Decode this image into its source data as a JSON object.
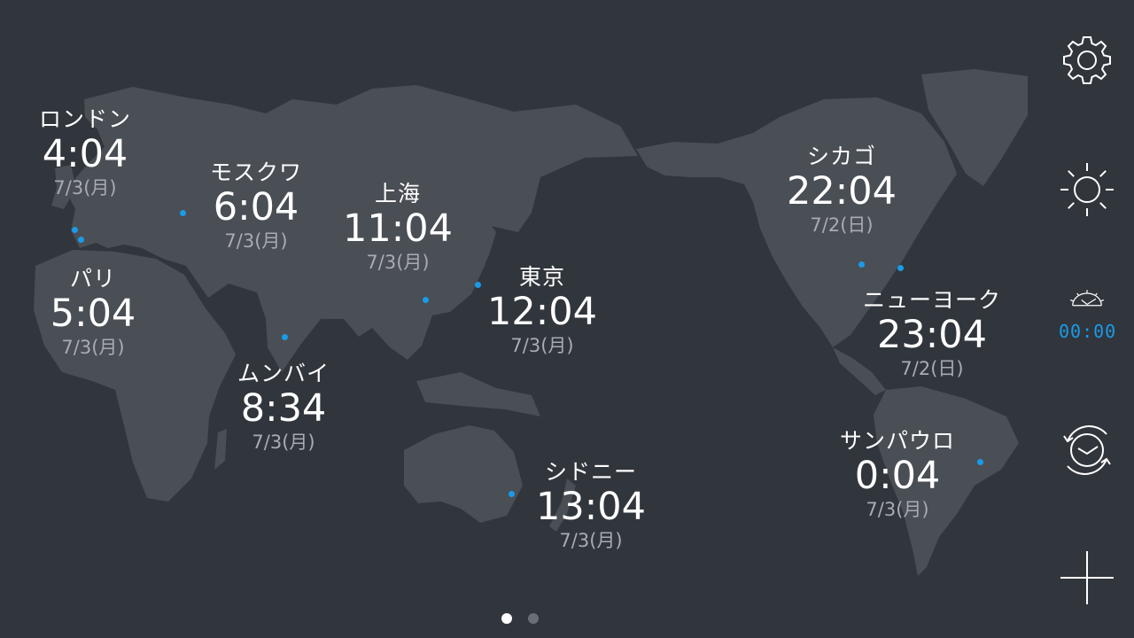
{
  "colors": {
    "background": "#31353c",
    "land": "#4a4e55",
    "accent": "#1a9be8",
    "date_text": "#a8acb2",
    "page_indicator_active": "#ffffff",
    "page_indicator_inactive": "#6a6e75"
  },
  "cities": [
    {
      "name": "ロンドン",
      "time": "4:04",
      "date": "7/3(月)"
    },
    {
      "name": "モスクワ",
      "time": "6:04",
      "date": "7/3(月)"
    },
    {
      "name": "上海",
      "time": "11:04",
      "date": "7/3(月)"
    },
    {
      "name": "パリ",
      "time": "5:04",
      "date": "7/3(月)"
    },
    {
      "name": "東京",
      "time": "12:04",
      "date": "7/3(月)"
    },
    {
      "name": "ムンバイ",
      "time": "8:34",
      "date": "7/3(月)"
    },
    {
      "name": "シドニー",
      "time": "13:04",
      "date": "7/3(月)"
    },
    {
      "name": "シカゴ",
      "time": "22:04",
      "date": "7/2(日)"
    },
    {
      "name": "ニューヨーク",
      "time": "23:04",
      "date": "7/2(日)"
    },
    {
      "name": "サンパウロ",
      "time": "0:04",
      "date": "7/3(月)"
    }
  ],
  "sidebar": {
    "items": [
      {
        "icon": "gear-icon"
      },
      {
        "icon": "brightness-icon"
      },
      {
        "icon": "alarm-clock-icon",
        "label": "00:00"
      },
      {
        "icon": "rotate-clock-icon"
      },
      {
        "icon": "plus-icon"
      }
    ]
  },
  "pager": {
    "pages": 2,
    "current": 1
  }
}
